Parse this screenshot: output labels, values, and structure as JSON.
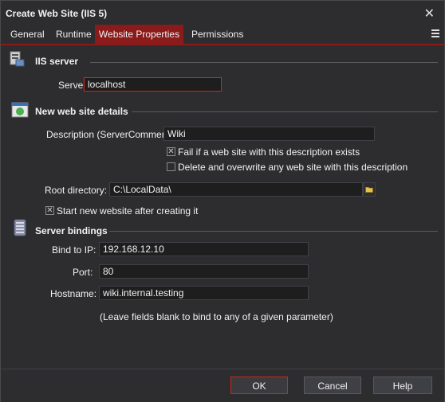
{
  "window": {
    "title": "Create Web Site (IIS 5)"
  },
  "tabs": [
    {
      "label": "General"
    },
    {
      "label": "Runtime"
    },
    {
      "label": "Website Properties"
    },
    {
      "label": "Permissions"
    }
  ],
  "iis_server": {
    "title": "IIS server",
    "server_label": "Server:",
    "server_value": "localhost"
  },
  "new_site": {
    "title": "New web site details",
    "description_label": "Description (ServerComment):",
    "description_value": "Wiki",
    "fail_if_exists_label": "Fail if a web site with this description exists",
    "fail_if_exists_checked": true,
    "delete_overwrite_label": "Delete and overwrite any web site with this description",
    "delete_overwrite_checked": false,
    "root_label": "Root directory:",
    "root_value": "C:\\LocalData\\",
    "start_label": "Start new website after creating it",
    "start_checked": true
  },
  "bindings": {
    "title": "Server bindings",
    "ip_label": "Bind to IP:",
    "ip_value": "192.168.12.10",
    "port_label": "Port:",
    "port_value": "80",
    "host_label": "Hostname:",
    "host_value": "wiki.internal.testing",
    "hint": "(Leave fields blank to bind to any of a given parameter)"
  },
  "footer": {
    "ok_label": "OK",
    "cancel_label": "Cancel",
    "help_label": "Help"
  },
  "colors": {
    "accent": "#8b1a1a",
    "focus_border": "#c42b1c",
    "background": "#2d2d30",
    "input_background": "#1e1e1e"
  }
}
